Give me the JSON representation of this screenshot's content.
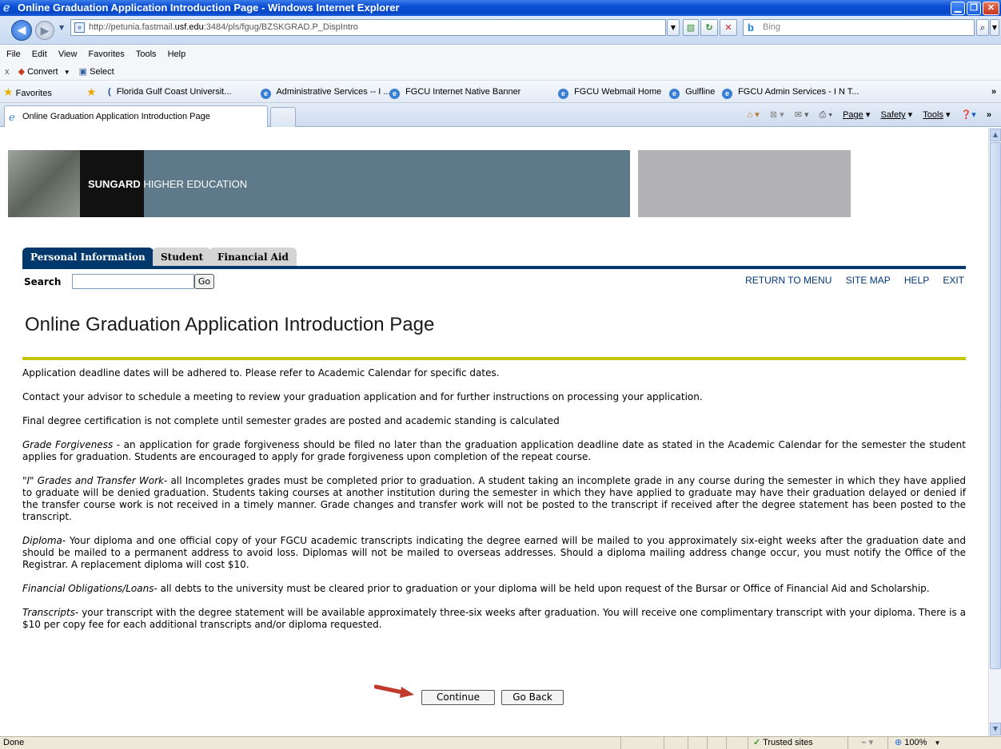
{
  "window": {
    "title": "Online Graduation Application Introduction Page - Windows Internet Explorer"
  },
  "browser": {
    "url_prefix": "http://petunia.fastmail.",
    "url_domain": "usf.edu",
    "url_suffix": ":3484/pls/fgug/BZSKGRAD.P_DispIntro",
    "search_placeholder": "Bing",
    "menu": [
      "File",
      "Edit",
      "View",
      "Favorites",
      "Tools",
      "Help"
    ],
    "commands": {
      "convert": "Convert",
      "select": "Select"
    },
    "favorites_label": "Favorites",
    "favorites": [
      "Florida Gulf Coast Universit...",
      "Administrative Services -- I ...",
      "FGCU Internet Native Banner",
      "FGCU Webmail Home",
      "Gulfline",
      "FGCU Admin Services - I N T..."
    ],
    "tab_title": "Online Graduation Application Introduction Page",
    "tab_tools": {
      "page": "Page",
      "safety": "Safety",
      "tools": "Tools"
    },
    "status": {
      "left": "Done",
      "zone": "Trusted sites",
      "zoom": "100%"
    }
  },
  "banner": {
    "brand_bold": "SUNGARD",
    "brand_rest": " HIGHER EDUCATION"
  },
  "nav_tabs": [
    "Personal Information",
    "Student",
    "Financial Aid"
  ],
  "search": {
    "label": "Search",
    "value": "",
    "button": "Go"
  },
  "top_links": [
    "RETURN TO MENU",
    "SITE MAP",
    "HELP",
    "EXIT"
  ],
  "page_title": "Online Graduation Application Introduction Page",
  "paragraphs": [
    {
      "lead": "",
      "text": "Application deadline dates will be adhered to. Please refer to Academic Calendar for specific dates."
    },
    {
      "lead": "",
      "text": "Contact your advisor to schedule a meeting to review your graduation application and for further instructions on processing your application."
    },
    {
      "lead": "",
      "text": "Final degree certification is not complete until semester grades are posted and academic standing is calculated"
    },
    {
      "lead": "Grade Forgiveness",
      "text": " - an application for grade forgiveness should be filed no later than the graduation application deadline date as stated in the Academic Calendar for the semester the student applies for graduation. Students are encouraged to apply for grade forgiveness upon completion of the repeat course."
    },
    {
      "lead": "\"I\" Grades and Transfer Work",
      "text": "- all Incompletes grades must be completed prior to graduation. A student taking an incomplete grade in any course during the semester in which they have applied to graduate will be denied graduation. Students taking courses at another institution during the semester in which they have applied to graduate may have their graduation delayed or denied if the transfer course work is not received in a timely manner. Grade changes and transfer work will not be posted to the transcript if received after the degree statement has been posted to the transcript."
    },
    {
      "lead": "Diploma",
      "text": "- Your diploma and one official copy of your FGCU academic transcripts indicating the degree earned will be mailed to you approximately six-eight weeks after the graduation date and should be mailed to a permanent address to avoid loss. Diplomas will not be mailed to overseas addresses. Should a diploma mailing address change occur, you must notify the Office of the Registrar. A replacement diploma will cost $10."
    },
    {
      "lead": "Financial Obligations/Loans",
      "text": "- all debts to the university must be cleared prior to graduation or your diploma will be held upon request of the Bursar or Office of Financial Aid and Scholarship."
    },
    {
      "lead": "Transcripts",
      "text": "- your transcript with the degree statement will be available approximately three-six weeks after graduation. You will receive one complimentary transcript with your diploma. There is a $10 per copy fee for each additional transcripts and/or diploma requested."
    }
  ],
  "buttons": {
    "continue": "Continue",
    "go_back": "Go Back"
  },
  "colors": {
    "nav_blue": "#00386b",
    "rule_yellow": "#c8c400",
    "link_blue": "#00387a",
    "arrow_red": "#c0392b"
  }
}
